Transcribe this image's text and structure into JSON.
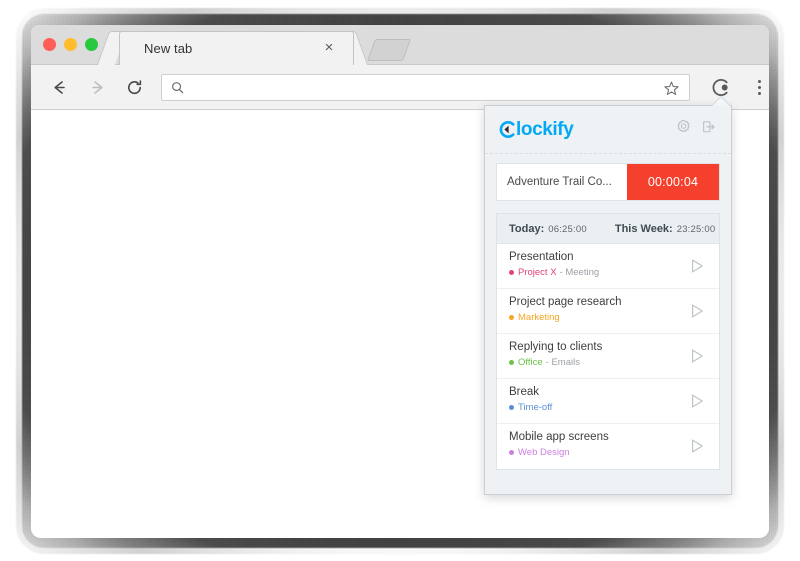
{
  "browser": {
    "tab": {
      "title": "New tab",
      "close_label": "×"
    },
    "new_tab_button": "new-tab",
    "toolbar": {
      "back": "back-arrow",
      "forward": "forward-arrow",
      "reload": "reload",
      "address_value": "",
      "address_placeholder": "",
      "search_icon": "search-icon",
      "bookmark_icon": "star-icon",
      "extension_icon": "clockify-extension-icon",
      "menu_icon": "three-dot-menu-icon"
    },
    "window_controls": [
      "close",
      "minimize",
      "maximize"
    ]
  },
  "popup": {
    "logo_text": "lockify",
    "logo_mark": "clockify-c-mark",
    "header_icons": [
      {
        "name": "settings-gear-icon",
        "label": "Settings"
      },
      {
        "name": "logout-icon",
        "label": "Log out"
      }
    ],
    "timer": {
      "description": "Adventure Trail Co...",
      "elapsed": "00:00:04",
      "button_color": "#f4402c",
      "running": true
    },
    "summary": {
      "today_label": "Today:",
      "today_value": "06:25:00",
      "week_label": "This Week:",
      "week_value": "23:25:00"
    },
    "entries": [
      {
        "title": "Presentation",
        "project": "Project X",
        "task": "- Meeting",
        "color": "#e0427f",
        "play": "play-icon"
      },
      {
        "title": "Project page research",
        "project": "Marketing",
        "task": "",
        "color": "#f5a623",
        "play": "play-icon"
      },
      {
        "title": "Replying to clients",
        "project": "Office",
        "task": "- Emails",
        "color": "#6cc24a",
        "play": "play-icon"
      },
      {
        "title": "Break",
        "project": "Time-off",
        "task": "",
        "color": "#5a8fd6",
        "play": "play-icon"
      },
      {
        "title": "Mobile app screens",
        "project": "Web Design",
        "task": "",
        "color": "#cc7fe0",
        "play": "play-icon"
      }
    ]
  },
  "colors": {
    "brand_blue": "#03a9f4",
    "timer_red": "#f4402c",
    "popup_bg": "#eef2f5"
  }
}
